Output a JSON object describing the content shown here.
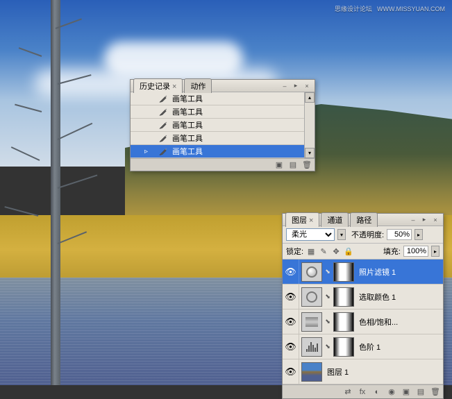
{
  "watermark": {
    "text": "思缘设计论坛",
    "url": "WWW.MISSYUAN.COM"
  },
  "history": {
    "tabs": [
      {
        "label": "历史记录",
        "active": true
      },
      {
        "label": "动作",
        "active": false
      }
    ],
    "items": [
      {
        "label": "画笔工具",
        "selected": false
      },
      {
        "label": "画笔工具",
        "selected": false
      },
      {
        "label": "画笔工具",
        "selected": false
      },
      {
        "label": "画笔工具",
        "selected": false
      },
      {
        "label": "画笔工具",
        "selected": true
      }
    ]
  },
  "layers": {
    "tabs": [
      {
        "label": "图层",
        "active": true
      },
      {
        "label": "通道",
        "active": false
      },
      {
        "label": "路径",
        "active": false
      }
    ],
    "blend_mode": "柔光",
    "opacity_label": "不透明度:",
    "opacity_value": "50%",
    "lock_label": "锁定:",
    "fill_label": "填充:",
    "fill_value": "100%",
    "items": [
      {
        "name": "照片滤镜 1",
        "type": "photo-filter",
        "selected": true,
        "visible": true
      },
      {
        "name": "选取颜色 1",
        "type": "selective-color",
        "selected": false,
        "visible": true
      },
      {
        "name": "色相/饱和...",
        "type": "hue-sat",
        "selected": false,
        "visible": true
      },
      {
        "name": "色阶 1",
        "type": "levels",
        "selected": false,
        "visible": true
      },
      {
        "name": "图层 1",
        "type": "image",
        "selected": false,
        "visible": true
      }
    ]
  }
}
